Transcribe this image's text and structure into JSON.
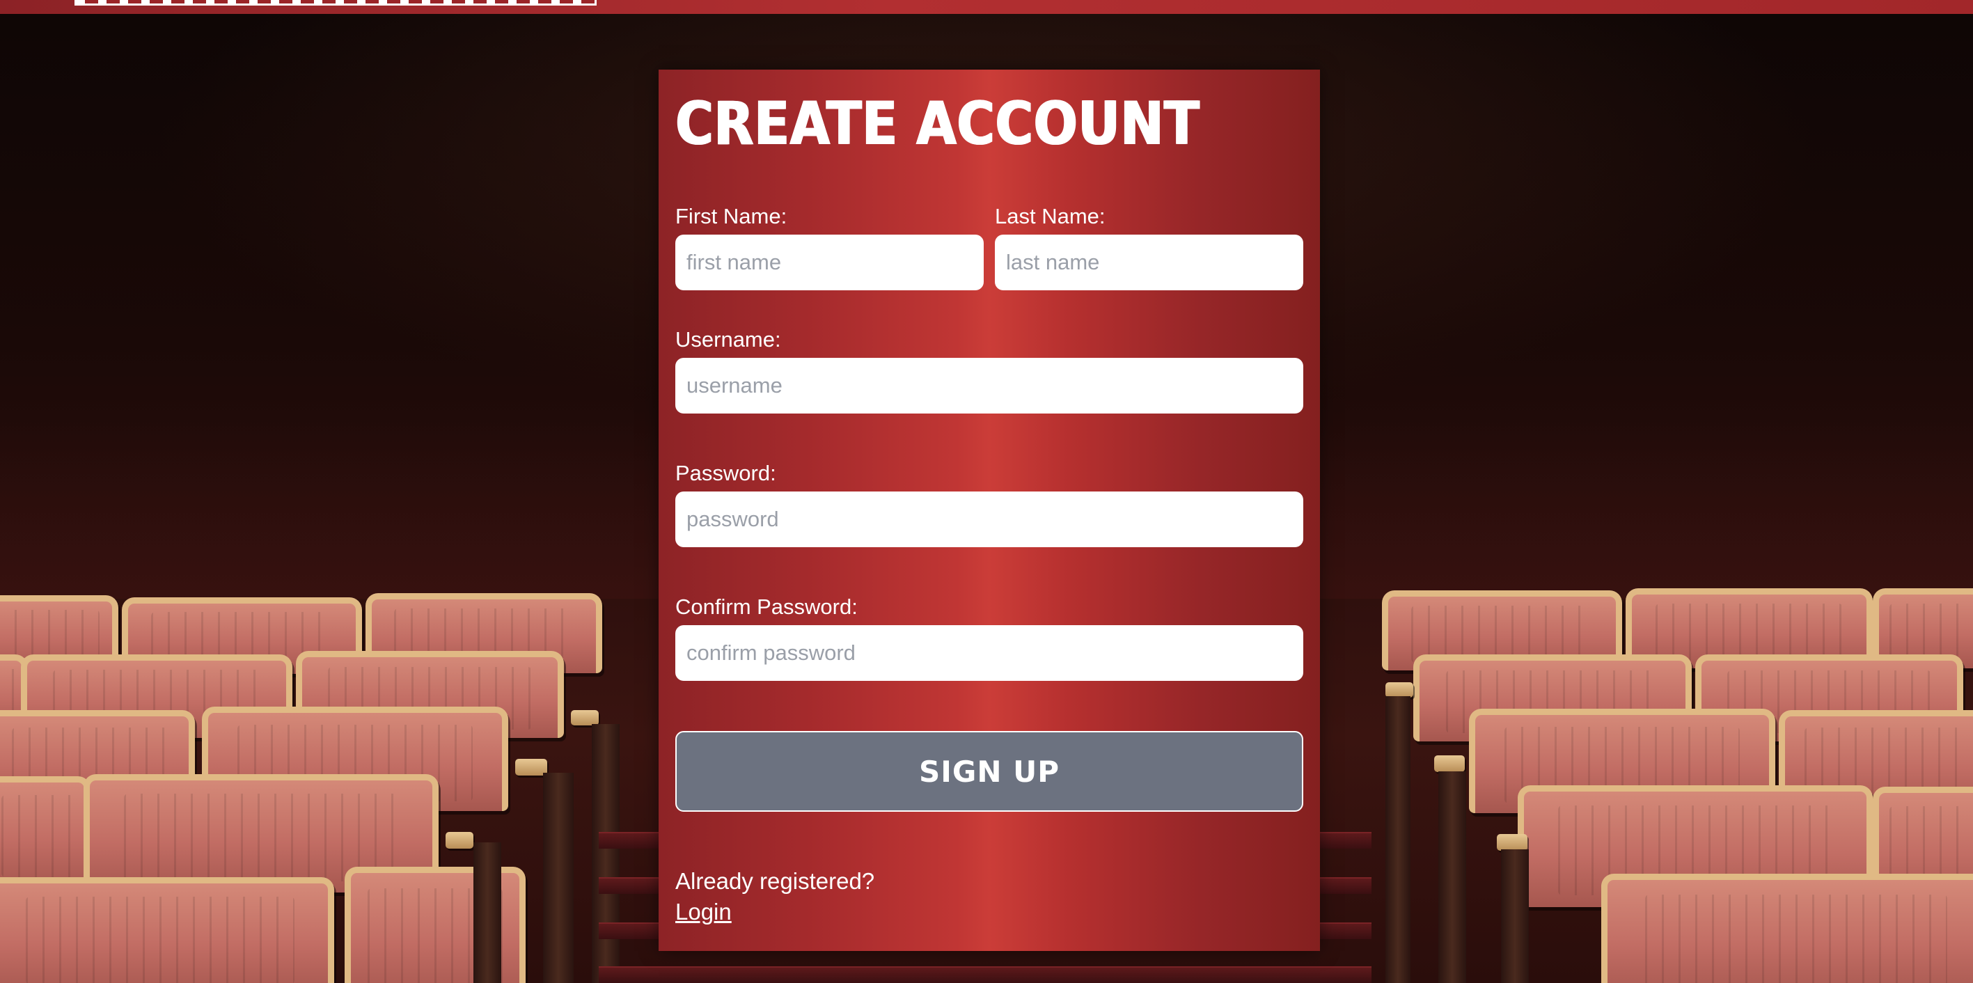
{
  "page": {
    "title": "CREATE ACCOUNT",
    "colors": {
      "topbar": "#a42a2c",
      "card_center": "#cb3d38",
      "card_edge": "#84201f",
      "button": "#6c7280",
      "text": "#ffffff",
      "placeholder": "#9a9fa8"
    }
  },
  "header": {
    "logo_icon": "site-logo-icon"
  },
  "form": {
    "first_name": {
      "label": "First Name:",
      "placeholder": "first name",
      "value": ""
    },
    "last_name": {
      "label": "Last Name:",
      "placeholder": "last name",
      "value": ""
    },
    "username": {
      "label": "Username:",
      "placeholder": "username",
      "value": ""
    },
    "password": {
      "label": "Password:",
      "placeholder": "password",
      "value": ""
    },
    "confirm_password": {
      "label": "Confirm Password:",
      "placeholder": "confirm password",
      "value": ""
    },
    "submit_label": "SIGN UP"
  },
  "footer": {
    "prompt": "Already registered?",
    "login_label": "Login"
  }
}
